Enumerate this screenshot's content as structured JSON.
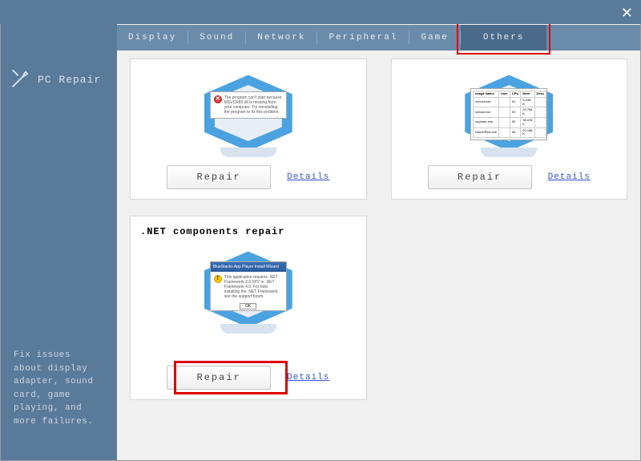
{
  "sidebar": {
    "title": "PC Repair",
    "description": "Fix issues about display adapter, sound card, game playing, and more failures."
  },
  "tabs": [
    {
      "label": "Display"
    },
    {
      "label": "Sound"
    },
    {
      "label": "Network"
    },
    {
      "label": "Peripheral"
    },
    {
      "label": "Game"
    },
    {
      "label": "Others",
      "active": true
    }
  ],
  "cards": {
    "topLeft": {
      "repair": "Repair",
      "details": "Details"
    },
    "topRight": {
      "repair": "Repair",
      "details": "Details"
    },
    "bottom": {
      "title": ".NET components repair",
      "repair": "Repair",
      "details": "Details",
      "dialogTitle": "BlueStacks App Player Install Wizard"
    }
  }
}
